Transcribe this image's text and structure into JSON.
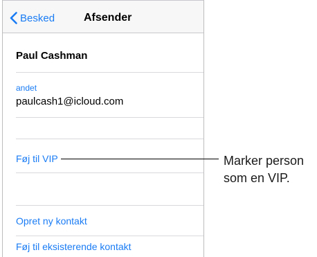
{
  "navbar": {
    "back_label": "Besked",
    "title": "Afsender"
  },
  "contact": {
    "name": "Paul Cashman",
    "email_type": "andet",
    "email": "paulcash1@icloud.com"
  },
  "actions": {
    "add_vip": "Føj til VIP",
    "new_contact": "Opret ny kontakt",
    "add_existing": "Føj til eksisterende kontakt"
  },
  "callout": {
    "line1": "Marker person",
    "line2": "som en VIP."
  },
  "colors": {
    "accent": "#1a7cf4",
    "navbar_bg": "#f7f7f7",
    "separator": "#d9d9dd"
  }
}
